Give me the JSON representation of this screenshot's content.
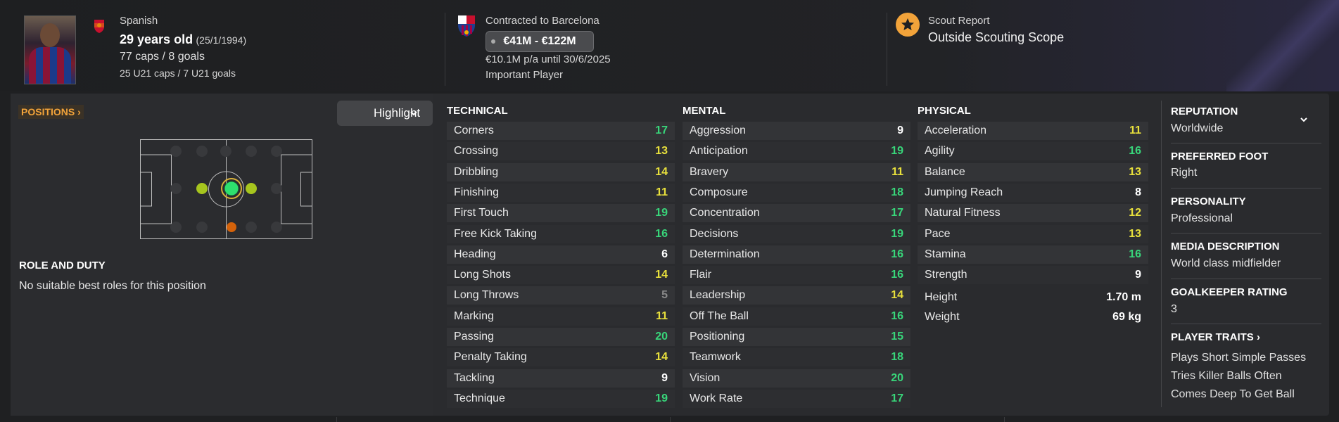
{
  "header": {
    "nationality": "Spanish",
    "age": "29 years old",
    "dob": "(25/1/1994)",
    "caps": "77 caps / 8 goals",
    "u21_caps": "25 U21 caps / 7 U21 goals",
    "contract_title": "Contracted to Barcelona",
    "value_range": "€41M - €122M",
    "wage": "€10.1M p/a until 30/6/2025",
    "squad_status": "Important Player",
    "scout_title": "Scout Report",
    "scout_value": "Outside Scouting Scope"
  },
  "positions": {
    "link_label": "POSITIONS",
    "highlight_label": "Highlight",
    "role_title": "ROLE AND DUTY",
    "role_text": "No suitable best roles for this position"
  },
  "technical": {
    "title": "TECHNICAL",
    "rows": [
      {
        "name": "Corners",
        "value": "17"
      },
      {
        "name": "Crossing",
        "value": "13"
      },
      {
        "name": "Dribbling",
        "value": "14"
      },
      {
        "name": "Finishing",
        "value": "11"
      },
      {
        "name": "First Touch",
        "value": "19"
      },
      {
        "name": "Free Kick Taking",
        "value": "16"
      },
      {
        "name": "Heading",
        "value": "6"
      },
      {
        "name": "Long Shots",
        "value": "14"
      },
      {
        "name": "Long Throws",
        "value": "5"
      },
      {
        "name": "Marking",
        "value": "11"
      },
      {
        "name": "Passing",
        "value": "20"
      },
      {
        "name": "Penalty Taking",
        "value": "14"
      },
      {
        "name": "Tackling",
        "value": "9"
      },
      {
        "name": "Technique",
        "value": "19"
      }
    ]
  },
  "mental": {
    "title": "MENTAL",
    "rows": [
      {
        "name": "Aggression",
        "value": "9"
      },
      {
        "name": "Anticipation",
        "value": "19"
      },
      {
        "name": "Bravery",
        "value": "11"
      },
      {
        "name": "Composure",
        "value": "18"
      },
      {
        "name": "Concentration",
        "value": "17"
      },
      {
        "name": "Decisions",
        "value": "19"
      },
      {
        "name": "Determination",
        "value": "16"
      },
      {
        "name": "Flair",
        "value": "16"
      },
      {
        "name": "Leadership",
        "value": "14"
      },
      {
        "name": "Off The Ball",
        "value": "16"
      },
      {
        "name": "Positioning",
        "value": "15"
      },
      {
        "name": "Teamwork",
        "value": "18"
      },
      {
        "name": "Vision",
        "value": "20"
      },
      {
        "name": "Work Rate",
        "value": "17"
      }
    ]
  },
  "physical": {
    "title": "PHYSICAL",
    "rows": [
      {
        "name": "Acceleration",
        "value": "11"
      },
      {
        "name": "Agility",
        "value": "16"
      },
      {
        "name": "Balance",
        "value": "13"
      },
      {
        "name": "Jumping Reach",
        "value": "8"
      },
      {
        "name": "Natural Fitness",
        "value": "12"
      },
      {
        "name": "Pace",
        "value": "13"
      },
      {
        "name": "Stamina",
        "value": "16"
      },
      {
        "name": "Strength",
        "value": "9"
      }
    ],
    "height_label": "Height",
    "height_value": "1.70 m",
    "weight_label": "Weight",
    "weight_value": "69 kg"
  },
  "info": {
    "reputation_label": "REPUTATION",
    "reputation_value": "Worldwide",
    "foot_label": "PREFERRED FOOT",
    "foot_value": "Right",
    "personality_label": "PERSONALITY",
    "personality_value": "Professional",
    "media_label": "MEDIA DESCRIPTION",
    "media_value": "World class midfielder",
    "gk_label": "GOALKEEPER RATING",
    "gk_value": "3",
    "traits_label": "PLAYER TRAITS",
    "traits": [
      "Plays Short Simple Passes",
      "Tries Killer Balls Often",
      "Comes Deep To Get Ball"
    ]
  },
  "colors": {
    "green": "#38d67a",
    "yellow": "#e8e03c",
    "white": "#ffffff",
    "grey": "#8a8a8a",
    "accent": "#f2a33a"
  }
}
